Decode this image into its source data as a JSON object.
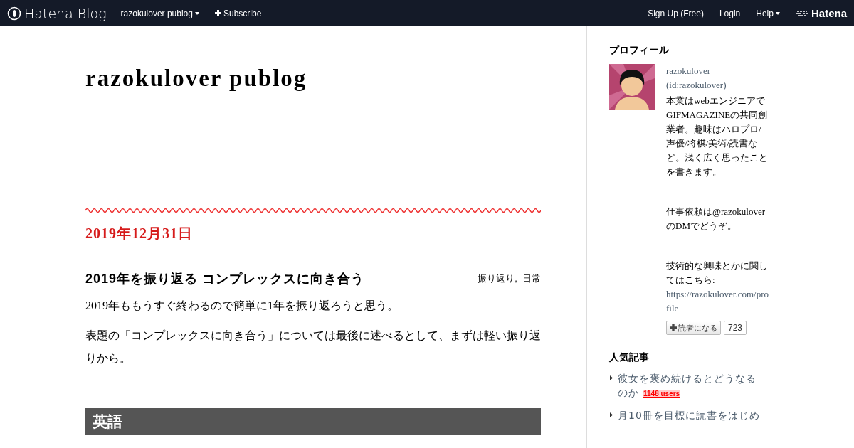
{
  "header": {
    "logo": "Hatena Blog",
    "blog_menu": "razokulover publog",
    "subscribe": "Subscribe",
    "sign_up": "Sign Up (Free)",
    "login": "Login",
    "help": "Help",
    "brand": "Hatena"
  },
  "blog": {
    "title": "razokulover publog"
  },
  "entry": {
    "date": "2019年12月31日",
    "title": "2019年を振り返る コンプレックスに向き合う",
    "categories": "振り返り,  日常",
    "paragraphs": [
      "2019年ももうすぐ終わるので簡単に1年を振り返ろうと思う。",
      "表題の「コンプレックスに向き合う」については最後に述べるとして、まずは軽い振り返りから。"
    ],
    "section_heading": "英語"
  },
  "profile": {
    "heading": "プロフィール",
    "name": "razokulover",
    "id": "(id:razokulover)",
    "bio": [
      "本業はwebエンジニアでGIFMAGAZINEの共同創業者。趣味はハロプロ/声優/将棋/美術/読書など。浅く広く思ったことを書きます。",
      "仕事依頼は@razokuloverのDMでどうぞ。",
      "技術的な興味とかに関してはこちら:"
    ],
    "link": "https://razokulover.com/profile",
    "subscribe_button": "読者になる",
    "subscriber_count": "723"
  },
  "popular": {
    "heading": "人気記事",
    "items": [
      {
        "title": "彼女を褒め続けるとどうなるのか",
        "users": "1148 users"
      },
      {
        "title": "月10冊を目標に読書をはじめ"
      }
    ]
  }
}
